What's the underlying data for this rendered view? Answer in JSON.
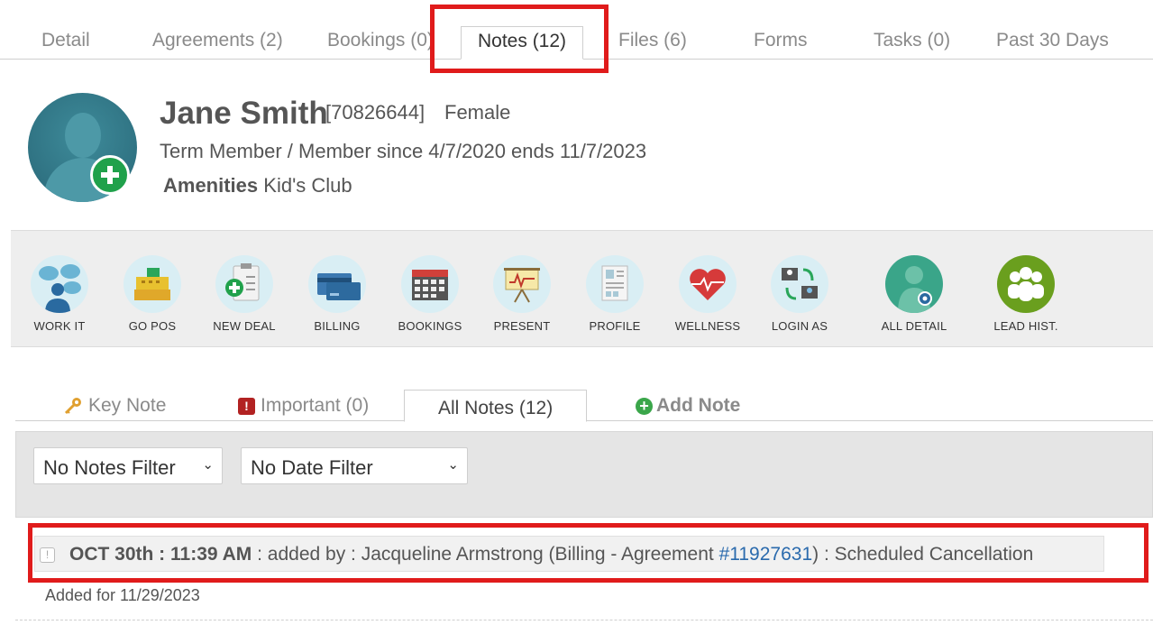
{
  "top_tabs": [
    {
      "label": "Detail"
    },
    {
      "label": "Agreements (2)"
    },
    {
      "label": "Bookings (0)"
    },
    {
      "label": "Notes (12)",
      "active": true
    },
    {
      "label": "Files (6)"
    },
    {
      "label": "Forms"
    },
    {
      "label": "Tasks (0)"
    },
    {
      "label": "Past 30 Days"
    }
  ],
  "member": {
    "name": "Jane Smith",
    "id": "[70826644]",
    "gender": "Female",
    "status": "Term Member / Member since 4/7/2020 ends 11/7/2023",
    "amenities_label": "Amenities",
    "amenities_value": "Kid's Club"
  },
  "actions": [
    {
      "label": "WORK IT",
      "icon": "chat-people-icon"
    },
    {
      "label": "GO POS",
      "icon": "cash-register-icon"
    },
    {
      "label": "NEW DEAL",
      "icon": "clipboard-plus-icon"
    },
    {
      "label": "BILLING",
      "icon": "credit-card-icon"
    },
    {
      "label": "BOOKINGS",
      "icon": "calendar-icon"
    },
    {
      "label": "PRESENT",
      "icon": "presentation-board-icon"
    },
    {
      "label": "PROFILE",
      "icon": "profile-document-icon"
    },
    {
      "label": "WELLNESS",
      "icon": "heart-pulse-icon"
    },
    {
      "label": "LOGIN AS",
      "icon": "switch-user-icon"
    },
    {
      "label": "ALL DETAIL",
      "icon": "person-gear-icon"
    },
    {
      "label": "LEAD HIST.",
      "icon": "group-people-icon"
    }
  ],
  "note_tabs": [
    {
      "label": "Key Note",
      "icon": "key-icon"
    },
    {
      "label": "Important (0)",
      "icon": "important-icon"
    },
    {
      "label": "All Notes (12)",
      "active": true
    },
    {
      "label": "Add Note",
      "icon": "add-icon"
    }
  ],
  "filters": {
    "notes_filter": "No Notes Filter",
    "date_filter": "No Date Filter"
  },
  "note": {
    "date": "OCT 30th : 11:39 AM",
    "text_before": " : added by : Jacqueline Armstrong (Billing - Agreement ",
    "agreement_link": "#11927631",
    "text_after": ") : Scheduled Cancellation",
    "added_for": "Added for 11/29/2023"
  },
  "colors": {
    "highlight": "#e01b1b",
    "link": "#2a6aad",
    "add_green": "#3aa64a",
    "avatar_teal": "#2f7282"
  }
}
